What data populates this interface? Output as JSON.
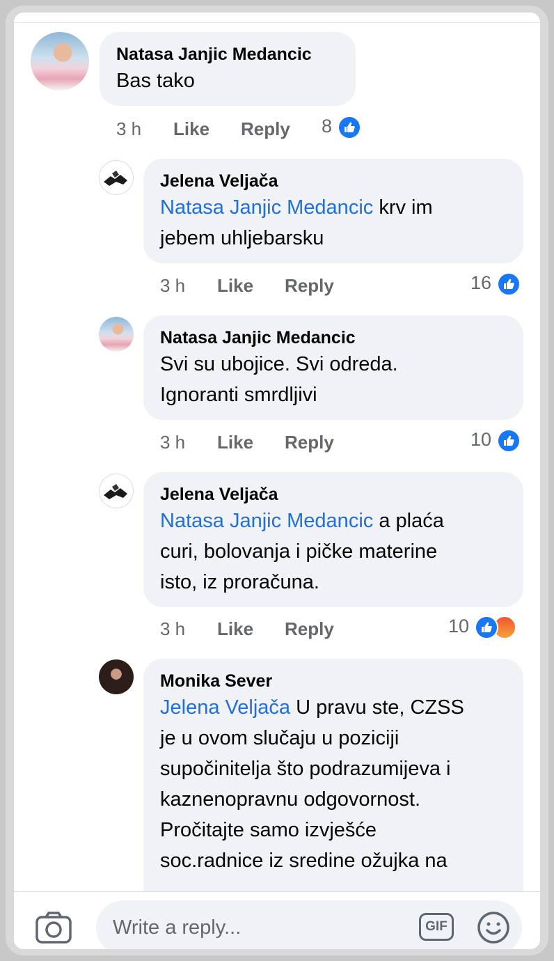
{
  "comments": [
    {
      "author": "Natasa Janjic Medancic",
      "mention": "",
      "text": "Bas tako",
      "time": "3 h",
      "like_label": "Like",
      "reply_label": "Reply",
      "reaction_count": "8",
      "reactions": [
        "like-icon"
      ]
    },
    {
      "author": "Jelena Veljača",
      "mention": "Natasa Janjic Medancic",
      "text_line1": " krv im",
      "text_line2": "jebem uhljebarsku",
      "time": "3 h",
      "like_label": "Like",
      "reply_label": "Reply",
      "reaction_count": "16",
      "reactions": [
        "like-icon"
      ]
    },
    {
      "author": "Natasa Janjic Medancic",
      "mention": "",
      "text_line1": "Svi su ubojice. Svi odreda.",
      "text_line2": "Ignoranti smrdljivi",
      "time": "3 h",
      "like_label": "Like",
      "reply_label": "Reply",
      "reaction_count": "10",
      "reactions": [
        "like-icon"
      ]
    },
    {
      "author": "Jelena Veljača",
      "mention": "Natasa Janjic Medancic",
      "text_line1": " a plaća",
      "text_line2": "curi, bolovanja i pičke materine",
      "text_line3": "isto, iz proračuna.",
      "time": "3 h",
      "like_label": "Like",
      "reply_label": "Reply",
      "reaction_count": "10",
      "reactions": [
        "like-icon",
        "angry-icon"
      ]
    },
    {
      "author": "Monika Sever",
      "mention": "Jelena Veljača",
      "text_line1": " U pravu ste, CZSS",
      "text_line2": "je u ovom slučaju u poziciji",
      "text_line3": "supočinitelja što podrazumijeva i",
      "text_line4": "kaznenopravnu odgovornost.",
      "text_line5": "Pročitajte samo izvješće",
      "text_line6": "soc.radnice iz sredine ožujka na"
    }
  ],
  "composer": {
    "placeholder": "Write a reply...",
    "gif_label": "GIF",
    "icons": [
      "camera-icon",
      "gif-icon",
      "emoji-icon"
    ]
  },
  "colors": {
    "mention": "#216fdb",
    "bubble": "#f0f2f5",
    "meta": "#65676b",
    "like": "#1877f2"
  }
}
